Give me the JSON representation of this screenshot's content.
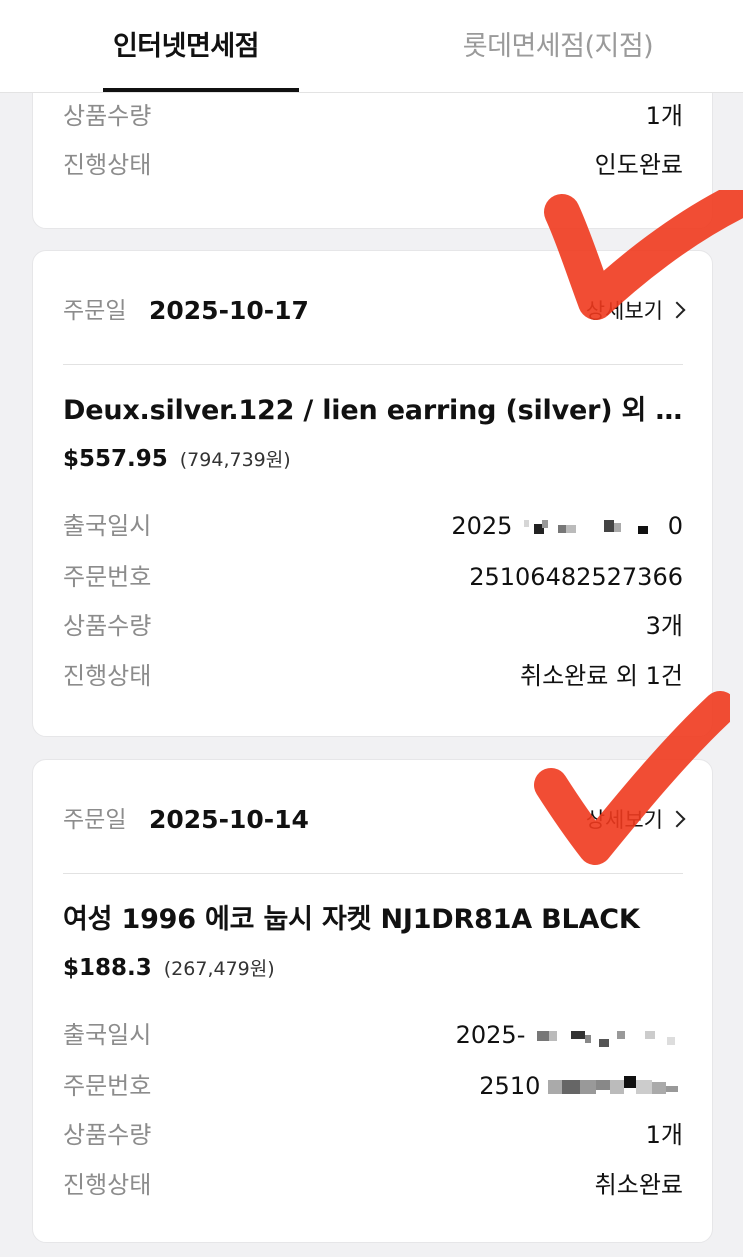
{
  "tabs": {
    "internet": "인터넷면세점",
    "branch": "롯데면세점(지점)"
  },
  "card1": {
    "rows": [
      {
        "label": "상품수량",
        "value": "1개"
      },
      {
        "label": "진행상태",
        "value": "인도완료"
      }
    ]
  },
  "card2": {
    "order_label": "주문일",
    "order_date": "2025-10-17",
    "detail_link": "상세보기",
    "product_name": "Deux.silver.122 / lien earring (silver) 외 …",
    "price_usd": "$557.95",
    "price_krw": "(794,739원)",
    "rows": [
      {
        "label": "출국일시",
        "value_prefix": "2025",
        "value_suffix": "0"
      },
      {
        "label": "주문번호",
        "value": "25106482527366"
      },
      {
        "label": "상품수량",
        "value": "3개"
      },
      {
        "label": "진행상태",
        "value": "취소완료 외 1건"
      }
    ]
  },
  "card3": {
    "order_label": "주문일",
    "order_date": "2025-10-14",
    "detail_link": "상세보기",
    "product_name": "여성 1996 에코 눕시 자켓 NJ1DR81A BLACK",
    "price_usd": "$188.3",
    "price_krw": "(267,479원)",
    "rows": [
      {
        "label": "출국일시",
        "value_prefix": "2025-"
      },
      {
        "label": "주문번호",
        "value_prefix": "2510"
      },
      {
        "label": "상품수량",
        "value": "1개"
      },
      {
        "label": "진행상태",
        "value": "취소완료"
      }
    ]
  },
  "colors": {
    "checkmark": "#f03a1e"
  }
}
